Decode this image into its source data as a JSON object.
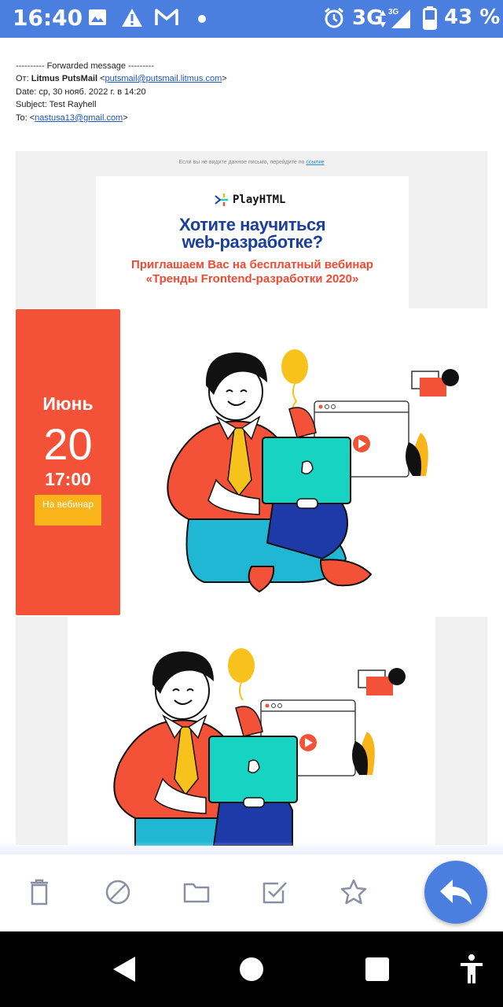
{
  "status_bar": {
    "time": "16:40",
    "icons_left": [
      "image-icon",
      "alert-icon",
      "gmail-icon",
      "dot-icon"
    ],
    "network": "3G",
    "network_small": "3G",
    "battery_percent": "43 %"
  },
  "forward_header": {
    "separator": "---------- Forwarded message ---------",
    "from_label": "От:",
    "from_name": "Litmus PutsMail",
    "from_email": "putsmail@putsmail.litmus.com",
    "date_line": "Date: ср, 30 нояб. 2022 г. в 14:20",
    "subject_line": "Subject: Test Rayhell",
    "to_label": "To:",
    "to_email": "nastusa13@gmail.com"
  },
  "email": {
    "preheader_text": "Если вы не видите данное письмо, перейдите по",
    "preheader_link": "ссылке",
    "logo_text": "PlayHTML",
    "headline_1": "Хотите научиться",
    "headline_2": "web-разработке?",
    "subline": "Приглашаем Вас на бесплатный вебинар «Тренды Frontend-разработки 2020»",
    "date_month": "Июнь",
    "date_day": "20",
    "date_time": "17:00",
    "cta_label": "На вебинар"
  },
  "action_bar": {
    "actions": [
      "trash-icon",
      "block-icon",
      "folder-icon",
      "mark-done-icon",
      "star-icon"
    ],
    "fab": "reply-icon"
  },
  "nav_bar": {
    "buttons": [
      "back-icon",
      "home-icon",
      "recents-icon",
      "accessibility-icon"
    ]
  },
  "colors": {
    "accent": "#4a7fe0",
    "brand_blue": "#1b3f9a",
    "brand_red": "#f45238",
    "cta_yellow": "#f8b418",
    "teal": "#17d3c2"
  }
}
